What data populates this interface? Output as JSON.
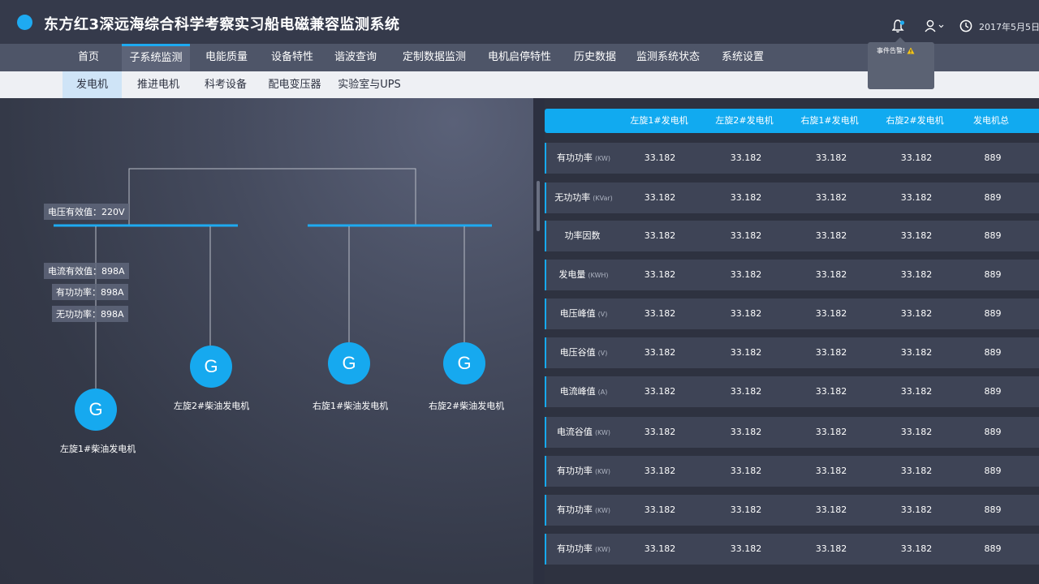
{
  "header": {
    "title": "东方红3深远海综合科学考察实习船电磁兼容监测系统",
    "date": "2017年5月5日",
    "alert_popover": "事件告警!",
    "accent_color": "#1eaaf1"
  },
  "nav": {
    "items": [
      {
        "label": "首页"
      },
      {
        "label": "子系统监测",
        "active": true
      },
      {
        "label": "电能质量"
      },
      {
        "label": "设备特性"
      },
      {
        "label": "谐波查询"
      },
      {
        "label": "定制数据监测"
      },
      {
        "label": "电机启停特性"
      },
      {
        "label": "历史数据"
      },
      {
        "label": "监测系统状态"
      },
      {
        "label": "系统设置"
      }
    ]
  },
  "subnav": {
    "items": [
      {
        "label": "发电机",
        "active": true
      },
      {
        "label": "推进电机"
      },
      {
        "label": "科考设备"
      },
      {
        "label": "配电变压器"
      },
      {
        "label": "实验室与UPS"
      }
    ]
  },
  "diagram": {
    "voltage_tag": "电压有效值：220V",
    "current_tag": "电流有效值：898A",
    "active_power_tag": "有功功率：898A",
    "reactive_power_tag": "无功功率：898A",
    "generators": [
      {
        "symbol": "G",
        "label": "左旋1#柴油发电机",
        "status_color": "#e0267a"
      },
      {
        "symbol": "G",
        "label": "左旋2#柴油发电机",
        "status_color": "#3ec33e"
      },
      {
        "symbol": "G",
        "label": "右旋1#柴油发电机",
        "status_color": "#e0267a"
      },
      {
        "symbol": "G",
        "label": "右旋2#柴油发电机",
        "status_color": "#e0267a"
      }
    ]
  },
  "table": {
    "headers": [
      "左旋1#发电机",
      "左旋2#发电机",
      "右旋1#发电机",
      "右旋2#发电机",
      "发电机总"
    ],
    "rows": [
      {
        "label": "有功功率",
        "unit": "(KW)",
        "values": [
          "33.182",
          "33.182",
          "33.182",
          "33.182",
          "889"
        ]
      },
      {
        "label": "无功功率",
        "unit": "(KVar)",
        "values": [
          "33.182",
          "33.182",
          "33.182",
          "33.182",
          "889"
        ]
      },
      {
        "label": "功率因数",
        "unit": "",
        "values": [
          "33.182",
          "33.182",
          "33.182",
          "33.182",
          "889"
        ]
      },
      {
        "label": "发电量",
        "unit": "(KWH)",
        "values": [
          "33.182",
          "33.182",
          "33.182",
          "33.182",
          "889"
        ]
      },
      {
        "label": "电压峰值",
        "unit": "(V)",
        "values": [
          "33.182",
          "33.182",
          "33.182",
          "33.182",
          "889"
        ]
      },
      {
        "label": "电压谷值",
        "unit": "(V)",
        "values": [
          "33.182",
          "33.182",
          "33.182",
          "33.182",
          "889"
        ]
      },
      {
        "label": "电流峰值",
        "unit": "(A)",
        "values": [
          "33.182",
          "33.182",
          "33.182",
          "33.182",
          "889"
        ]
      },
      {
        "label": "电流谷值",
        "unit": "(KW)",
        "values": [
          "33.182",
          "33.182",
          "33.182",
          "33.182",
          "889"
        ]
      },
      {
        "label": "有功功率",
        "unit": "(KW)",
        "values": [
          "33.182",
          "33.182",
          "33.182",
          "33.182",
          "889"
        ]
      },
      {
        "label": "有功功率",
        "unit": "(KW)",
        "values": [
          "33.182",
          "33.182",
          "33.182",
          "33.182",
          "889"
        ]
      },
      {
        "label": "有功功率",
        "unit": "(KW)",
        "values": [
          "33.182",
          "33.182",
          "33.182",
          "33.182",
          "889"
        ]
      }
    ]
  }
}
